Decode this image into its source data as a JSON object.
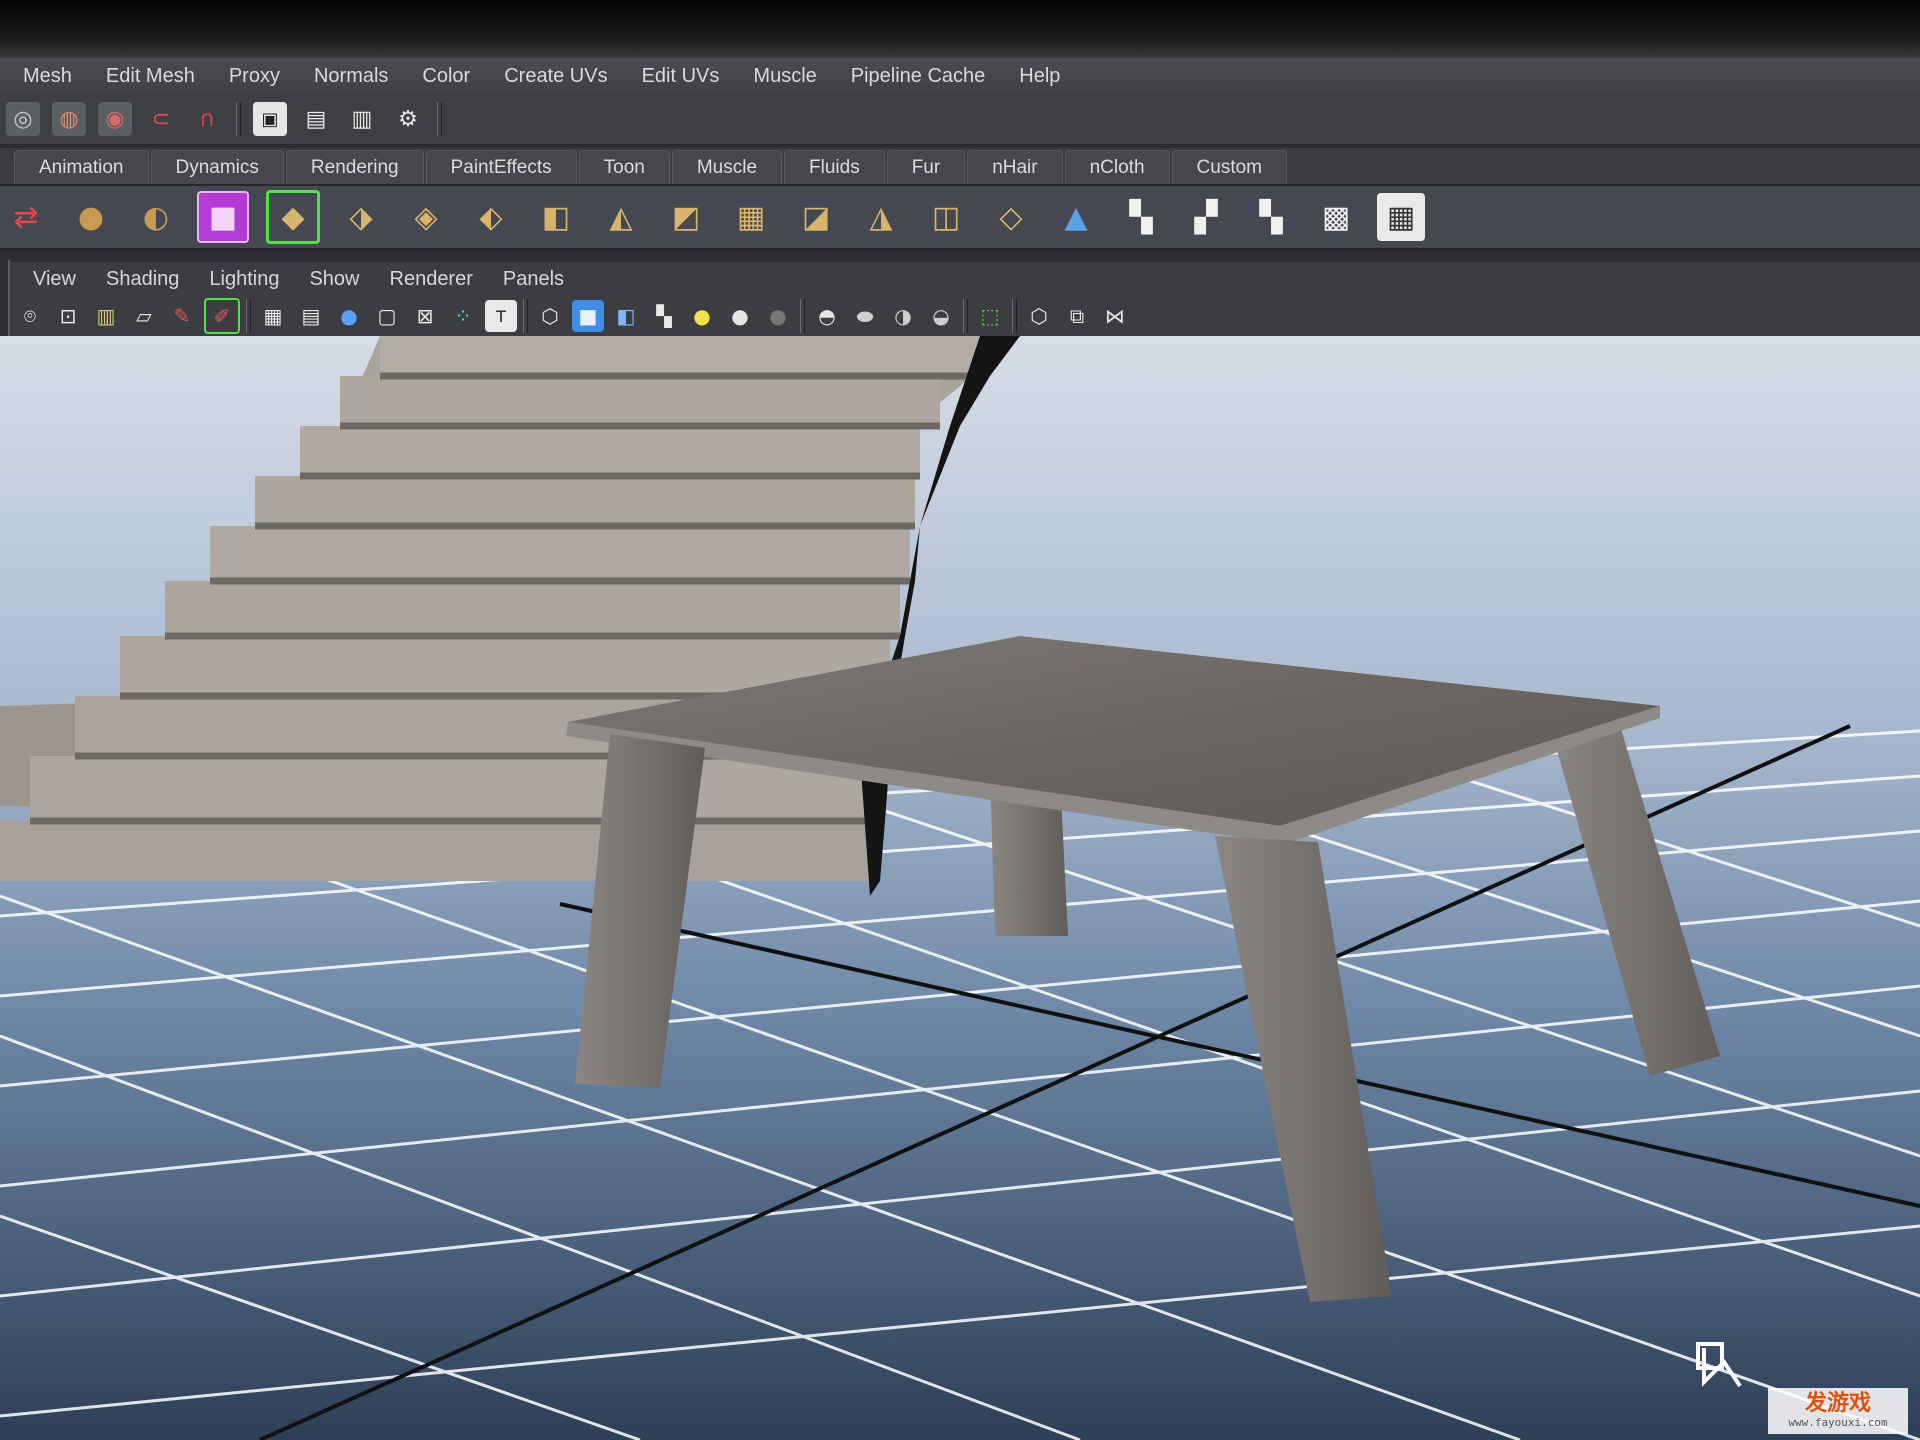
{
  "menubar": {
    "items": [
      "Mesh",
      "Edit Mesh",
      "Proxy",
      "Normals",
      "Color",
      "Create UVs",
      "Edit UVs",
      "Muscle",
      "Pipeline Cache",
      "Help"
    ]
  },
  "shelf_tabs": {
    "items": [
      "Animation",
      "Dynamics",
      "Rendering",
      "PaintEffects",
      "Toon",
      "Muscle",
      "Fluids",
      "Fur",
      "nHair",
      "nCloth",
      "Custom"
    ]
  },
  "panel_menu": {
    "items": [
      "View",
      "Shading",
      "Lighting",
      "Show",
      "Renderer",
      "Panels"
    ]
  },
  "icons": {
    "status": [
      "snap-curve-icon",
      "snap-point-icon",
      "snap-view-icon",
      "magnet-live-icon",
      "magnet-icon",
      "render-frame-icon",
      "clapboard-icon",
      "clapboard-ipr-icon",
      "clapboard-settings-icon"
    ],
    "shelf": [
      "combine-icon",
      "sphere-icon",
      "sphere-cut-icon",
      "cube-purple-icon",
      "bevel-icon",
      "extrude-face-icon",
      "split-poly-icon",
      "append-poly-icon",
      "merge-icon",
      "triangulate-icon",
      "quadrangulate-icon",
      "smooth-icon",
      "reduce-icon",
      "cleanup-icon",
      "uv-layout-icon",
      "uv-planar-icon",
      "normals-icon",
      "checker-uv-icon",
      "uv-cut-icon",
      "uv-sew-icon",
      "uv-unfold-icon",
      "uv-texture-editor-icon"
    ],
    "panel": [
      "camera-attributes-icon",
      "camera-lock-icon",
      "bookmark-icon",
      "image-plane-icon",
      "grease-pencil-icon",
      "two-d-pan-icon",
      "grid-icon",
      "film-gate-icon",
      "resolution-gate-icon",
      "safe-area-icon",
      "field-chart-icon",
      "safe-title-icon",
      "wireframe-icon",
      "smooth-shade-icon",
      "wireframe-on-shaded-icon",
      "textured-icon",
      "use-lights-icon",
      "default-light-icon",
      "shadows-icon",
      "screen-ambient-icon",
      "motion-blur-icon",
      "depth-of-field-icon",
      "select-camera-icon",
      "isolate-icon",
      "xray-icon",
      "joints-icon"
    ]
  },
  "colors": {
    "ui_text": "#d9dadc",
    "grid_line": "#ffffff",
    "floor_top": "#7f98b8",
    "floor_bottom": "#3e5878",
    "table": "#6d6a68",
    "stairs": "#a7a09a"
  },
  "watermark": {
    "main": "发游戏",
    "sub": "www.fayouxi.com"
  }
}
